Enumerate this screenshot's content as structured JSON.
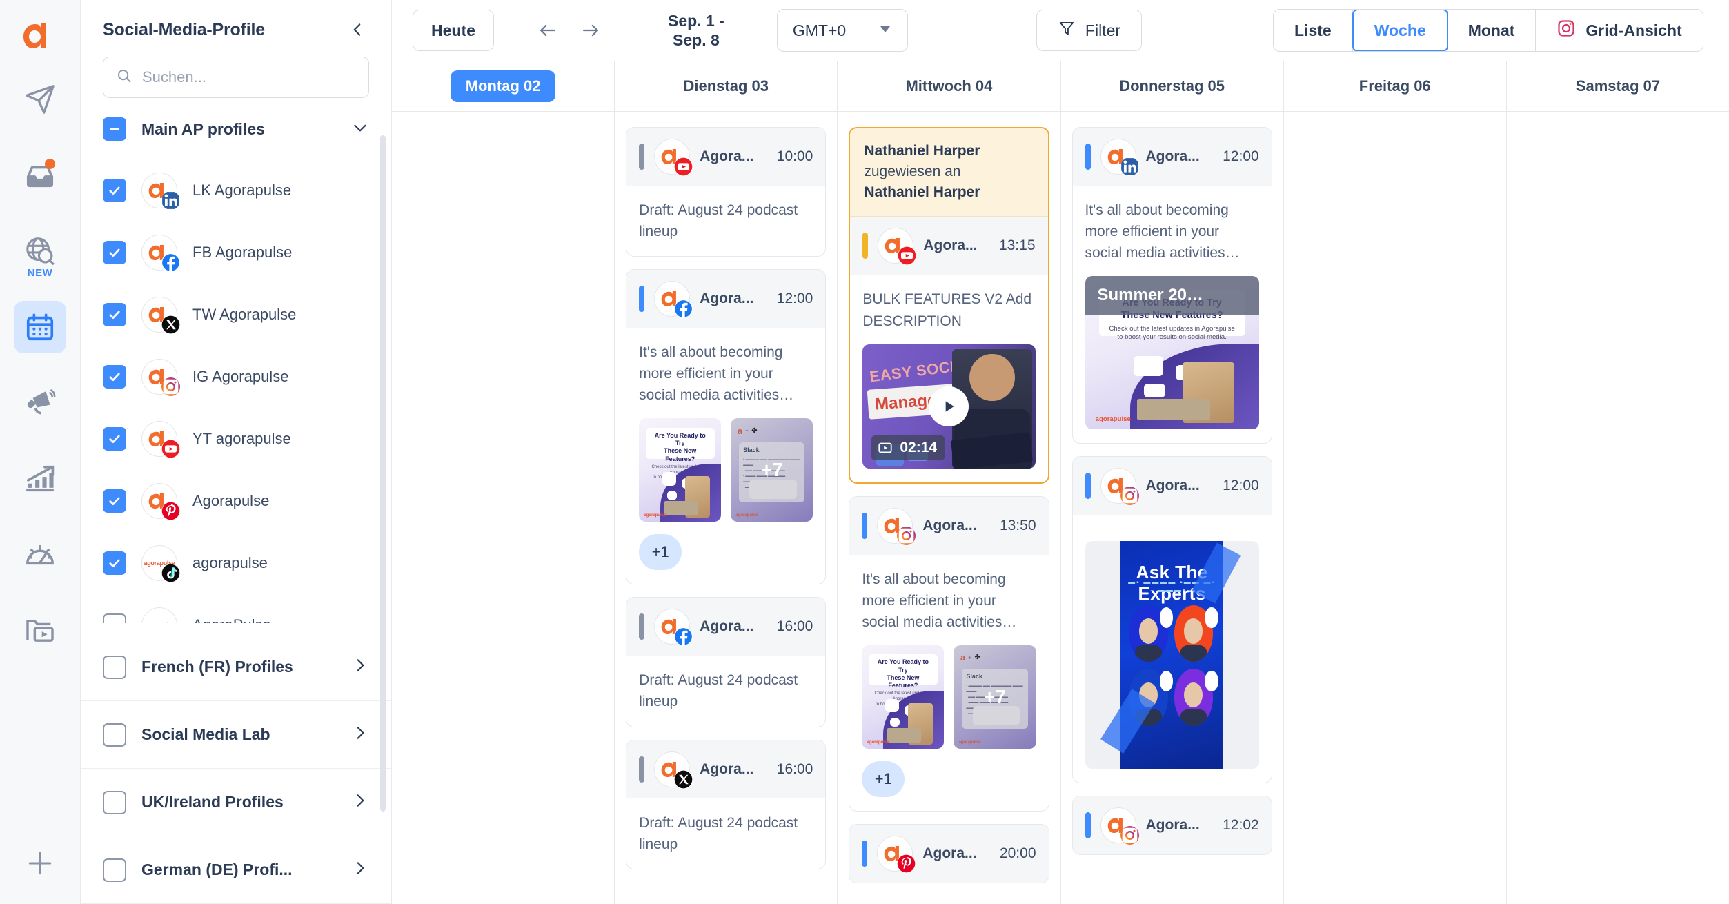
{
  "rail": {
    "logo": "agorapulse-logo",
    "items": [
      {
        "name": "publishing-icon",
        "icon": "paper-plane",
        "active": false,
        "badge": null,
        "dot": false
      },
      {
        "name": "inbox-icon",
        "icon": "inbox",
        "active": false,
        "badge": null,
        "dot": true
      },
      {
        "name": "listening-icon",
        "icon": "globe-search",
        "active": false,
        "badge": "NEW",
        "dot": false
      },
      {
        "name": "calendar-icon",
        "icon": "calendar",
        "active": true,
        "badge": null,
        "dot": false
      },
      {
        "name": "advocacy-icon",
        "icon": "megaphone",
        "active": false,
        "badge": null,
        "dot": false
      },
      {
        "name": "reports-icon",
        "icon": "bar-chart-arrow",
        "active": false,
        "badge": null,
        "dot": false
      },
      {
        "name": "roi-icon",
        "icon": "gauge",
        "active": false,
        "badge": null,
        "dot": false
      },
      {
        "name": "library-icon",
        "icon": "folder-video",
        "active": false,
        "badge": null,
        "dot": false
      }
    ],
    "add_label": "+"
  },
  "sidebar": {
    "title": "Social-Media-Profile",
    "collapse_icon": "chevron-left-icon",
    "search": {
      "placeholder": "Suchen...",
      "value": ""
    },
    "group": {
      "label": "Main AP profiles",
      "checkbox_state": "partial",
      "expand_icon": "chevron-down-icon"
    },
    "profiles": [
      {
        "name": "LK Agorapulse",
        "network": "linkedin",
        "checked": true,
        "avatar": "agorapulse-a"
      },
      {
        "name": "FB Agorapulse",
        "network": "facebook",
        "checked": true,
        "avatar": "agorapulse-a"
      },
      {
        "name": "TW Agorapulse",
        "network": "x",
        "checked": true,
        "avatar": "agorapulse-a"
      },
      {
        "name": "IG Agorapulse",
        "network": "instagram",
        "checked": true,
        "avatar": "agorapulse-a"
      },
      {
        "name": "YT agorapulse",
        "network": "youtube",
        "checked": true,
        "avatar": "agorapulse-a"
      },
      {
        "name": "Agorapulse",
        "network": "pinterest",
        "checked": true,
        "avatar": "agorapulse-a"
      },
      {
        "name": "agorapulse",
        "network": "tiktok",
        "checked": true,
        "avatar": "agorapulse-word"
      },
      {
        "name": "AgoraPulse",
        "network": "google-business",
        "checked": false,
        "avatar": "agorapulse-word"
      }
    ],
    "collapsed_groups": [
      {
        "label": "French (FR) Profiles",
        "checked": false
      },
      {
        "label": "Social Media Lab",
        "checked": false
      },
      {
        "label": "UK/Ireland Profiles",
        "checked": false
      },
      {
        "label": "German (DE) Profi...",
        "checked": false
      }
    ]
  },
  "toolbar": {
    "today_label": "Heute",
    "prev_icon": "arrow-left-icon",
    "next_icon": "arrow-right-icon",
    "date_range_line1": "Sep. 1 -",
    "date_range_line2": "Sep. 8",
    "timezone": "GMT+0",
    "timezone_caret": "caret-down-icon",
    "filter_label": "Filter",
    "filter_icon": "funnel-icon",
    "views": [
      {
        "label": "Liste",
        "active": false,
        "icon": null
      },
      {
        "label": "Woche",
        "active": true,
        "icon": null
      },
      {
        "label": "Monat",
        "active": false,
        "icon": null
      },
      {
        "label": "Grid-Ansicht",
        "active": false,
        "icon": "instagram-icon"
      }
    ]
  },
  "calendar": {
    "days": [
      {
        "label": "Montag 02",
        "today": true
      },
      {
        "label": "Dienstag 03",
        "today": false
      },
      {
        "label": "Mittwoch 04",
        "today": false
      },
      {
        "label": "Donnerstag 05",
        "today": false
      },
      {
        "label": "Freitag 06",
        "today": false
      },
      {
        "label": "Samstag 07",
        "today": false
      }
    ],
    "columns": [
      {
        "day": "Montag 02",
        "cards": []
      },
      {
        "day": "Dienstag 03",
        "cards": [
          {
            "profile": "Agora...",
            "time": "10:00",
            "network": "youtube",
            "bar_color": "#8a93a5",
            "text": "Draft: August 24 podcast lineup",
            "media": null,
            "extra": null,
            "selected": false,
            "assignment": null
          },
          {
            "profile": "Agora...",
            "time": "12:00",
            "network": "facebook",
            "bar_color": "#3d8bfd",
            "text": "It's all about becoming more efficient in your social media activities…",
            "media": "thumbs",
            "extra": "+7",
            "plus_badge": "+1",
            "selected": false,
            "assignment": null
          },
          {
            "profile": "Agora...",
            "time": "16:00",
            "network": "facebook",
            "bar_color": "#8a93a5",
            "text": "Draft: August 24 podcast lineup",
            "media": null,
            "extra": null,
            "selected": false,
            "assignment": null
          },
          {
            "profile": "Agora...",
            "time": "16:00",
            "network": "x",
            "bar_color": "#8a93a5",
            "text": "Draft: August 24 podcast lineup",
            "media": null,
            "extra": null,
            "selected": false,
            "assignment": null
          }
        ]
      },
      {
        "day": "Mittwoch 04",
        "cards": [
          {
            "profile": "Agora...",
            "time": "13:15",
            "network": "youtube",
            "bar_color": "#f0b429",
            "text": "BULK FEATURES V2 Add DESCRIPTION",
            "media": "video",
            "video_duration": "02:14",
            "selected": true,
            "assignment": {
              "assignee": "Nathaniel Harper",
              "middle": "zugewiesen an",
              "assigned_to": "Nathaniel Harper"
            }
          },
          {
            "profile": "Agora...",
            "time": "13:50",
            "network": "instagram",
            "bar_color": "#3d8bfd",
            "text": "It's all about becoming more efficient in your social media activities…",
            "media": "thumbs",
            "extra": "+7",
            "plus_badge": "+1",
            "selected": false,
            "assignment": null
          },
          {
            "profile": "Agora...",
            "time": "20:00",
            "network": "pinterest",
            "bar_color": "#3d8bfd",
            "text": "",
            "media": null,
            "selected": false,
            "assignment": null
          }
        ]
      },
      {
        "day": "Donnerstag 05",
        "cards": [
          {
            "profile": "Agora...",
            "time": "12:00",
            "network": "linkedin",
            "bar_color": "#3d8bfd",
            "text": "It's all about becoming more efficient in your social media activities…",
            "media": "image",
            "image_caption": "Summer 20…",
            "selected": false,
            "assignment": null
          },
          {
            "profile": "Agora...",
            "time": "12:00",
            "network": "instagram",
            "bar_color": "#3d8bfd",
            "text": "",
            "media": "experts",
            "selected": false,
            "assignment": null
          },
          {
            "profile": "Agora...",
            "time": "12:02",
            "network": "instagram",
            "bar_color": "#3d8bfd",
            "text": "",
            "media": null,
            "selected": false,
            "assignment": null
          }
        ]
      },
      {
        "day": "Freitag 06",
        "cards": []
      },
      {
        "day": "Samstag 07",
        "cards": []
      }
    ],
    "media_art": {
      "features_title_line1": "Are You Ready to Try",
      "features_title_line2": "These New Features?",
      "features_sub_line1": "Check out the latest updates in Agorapulse",
      "features_sub_line2": "to boost your results on social media.",
      "features_brand": "agorapulse",
      "slack_label": "Slack",
      "experts_title": "Ask The Experts",
      "video_word1": "EASY SOCIAL",
      "video_word2": "Management?"
    }
  },
  "colors": {
    "brand_orange": "#f26c2b",
    "accent_blue": "#3d8bfd",
    "selected_amber": "#f0a830",
    "text_dark": "#2b3a55"
  }
}
